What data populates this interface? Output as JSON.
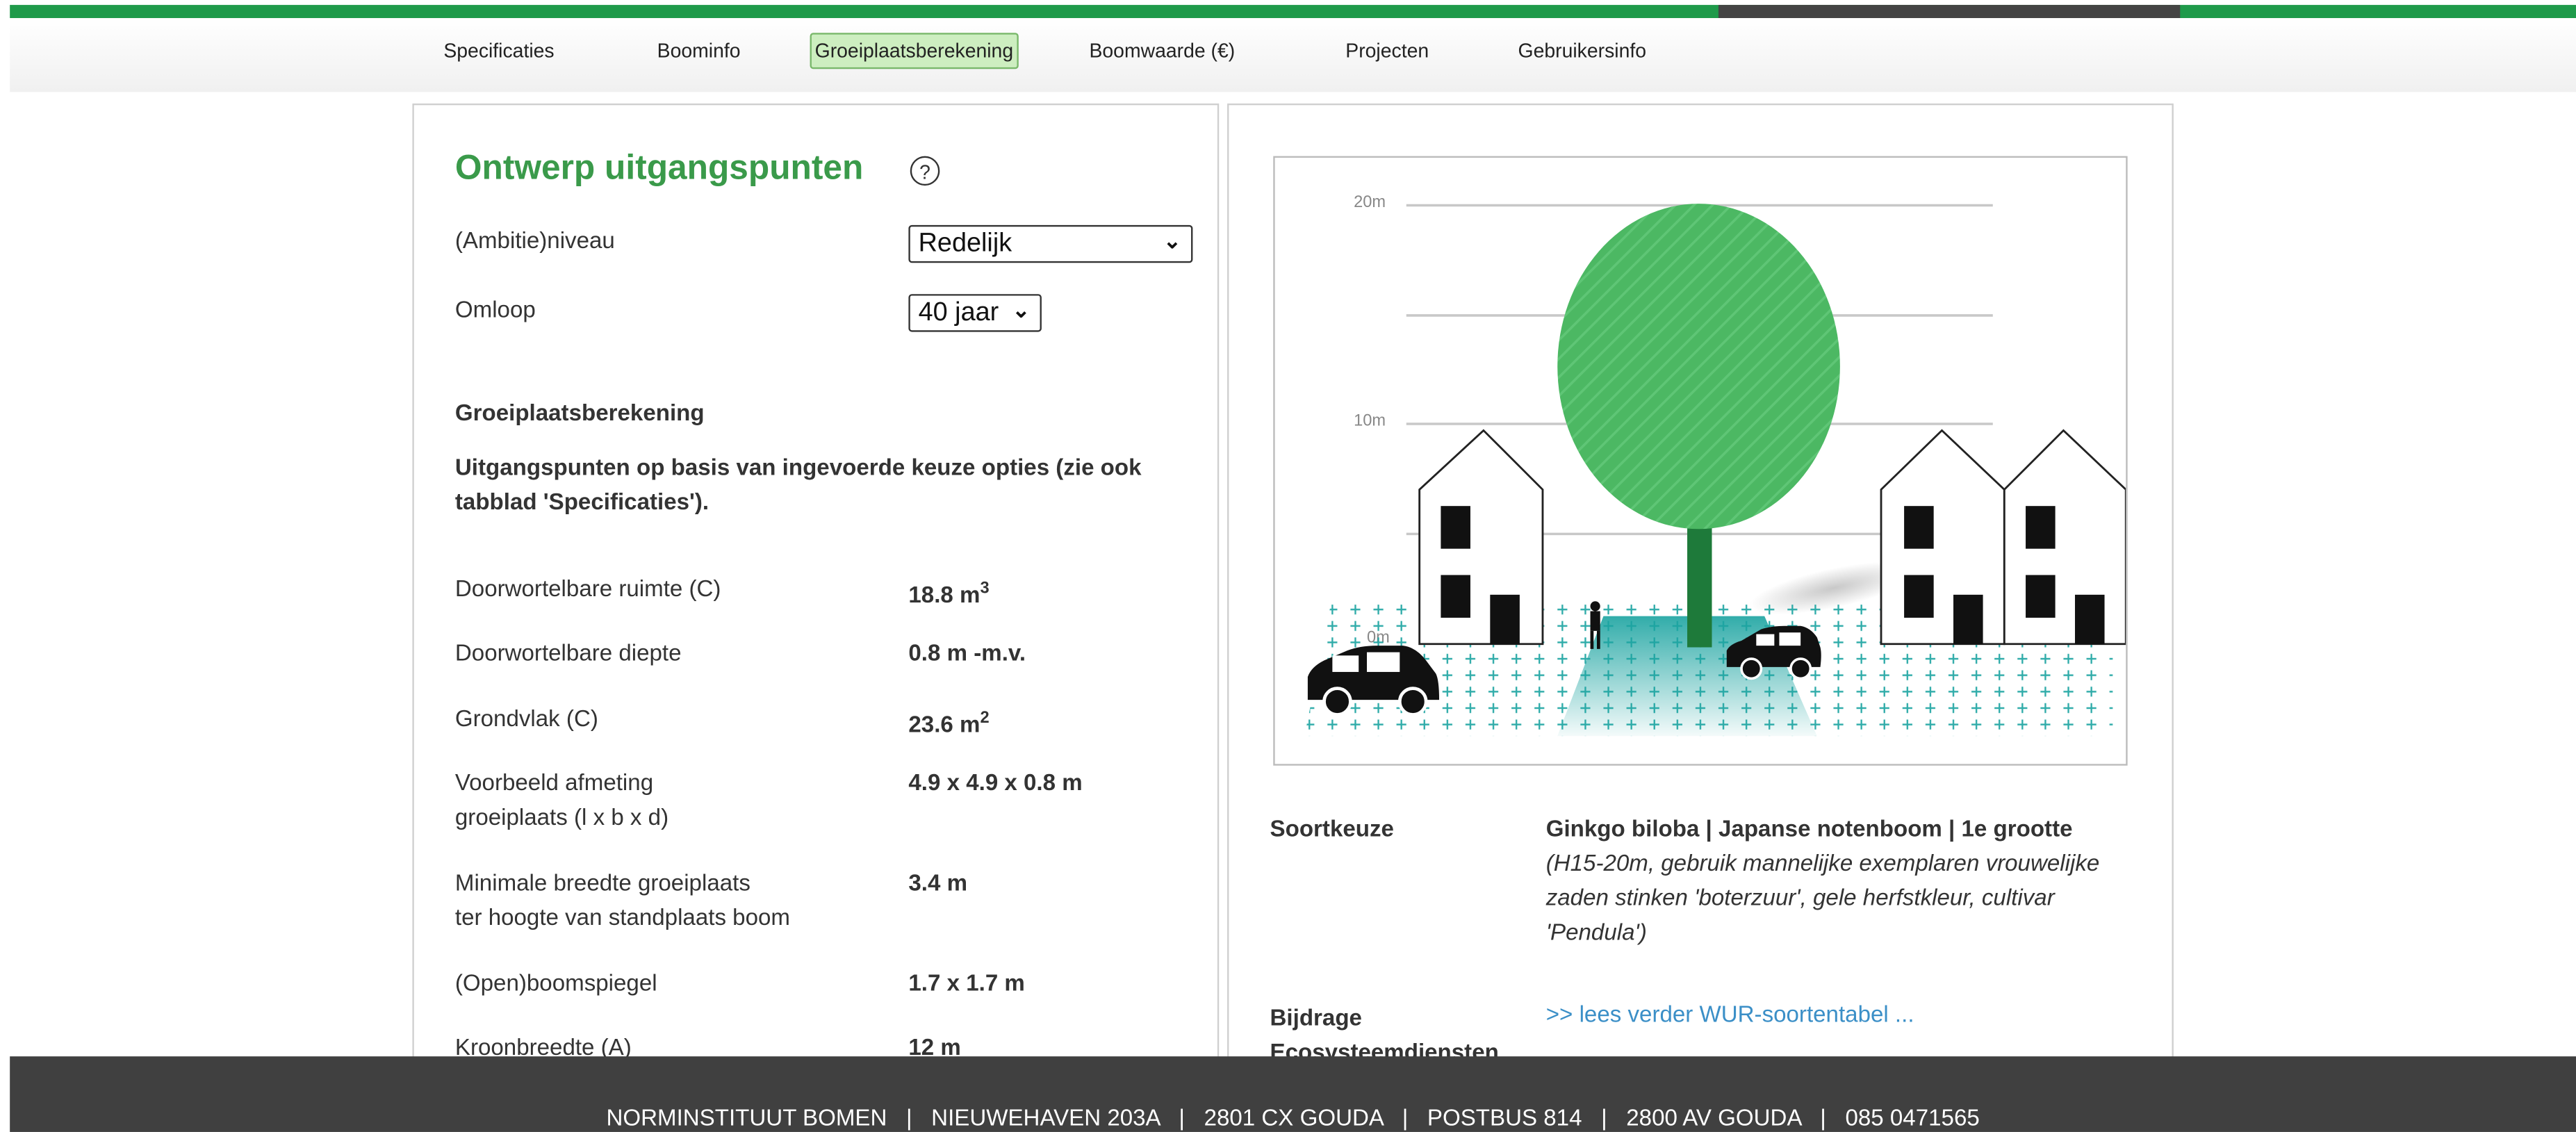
{
  "nav": {
    "items": [
      {
        "label": "Specificaties"
      },
      {
        "label": "Boominfo"
      },
      {
        "label": "Groeiplaatsberekening",
        "active": true
      },
      {
        "label": "Boomwaarde (€)"
      },
      {
        "label": "Projecten"
      },
      {
        "label": "Gebruikersinfo"
      }
    ]
  },
  "left": {
    "title": "Ontwerp uitgangspunten",
    "help_glyph": "?",
    "ambitie_label": "(Ambitie)niveau",
    "ambitie_value": "Redelijk",
    "omloop_label": "Omloop",
    "omloop_value": "40 jaar",
    "section_title": "Groeiplaatsberekening",
    "section_intro": "Uitgangspunten op basis van ingevoerde keuze opties (zie ook tabblad 'Specificaties').",
    "rows": [
      {
        "label": "Doorwortelbare ruimte (C)",
        "value": "18.8 m",
        "sup": "3"
      },
      {
        "label": "Doorwortelbare diepte",
        "value": "0.8 m -m.v."
      },
      {
        "label": "Grondvlak (C)",
        "value": "23.6 m",
        "sup": "2"
      },
      {
        "label": "Voorbeeld afmeting",
        "label2": "groeiplaats (l x b x d)",
        "value": "4.9 x 4.9 x 0.8 m"
      },
      {
        "label": "Minimale breedte groeiplaats",
        "label2": "ter hoogte van standplaats boom",
        "value": "3.4 m"
      },
      {
        "label": "(Open)boomspiegel",
        "value": "1.7 x 1.7 m"
      },
      {
        "label": "Kroonbreedte (A)",
        "value": "12 m"
      }
    ]
  },
  "illustration": {
    "height_labels": [
      "20m",
      "10m",
      "0m"
    ],
    "tree_color": "#4cb863",
    "trunk_color": "#1e7a3a",
    "soil_color": "#1aa3a0"
  },
  "right": {
    "soort_label": "Soortkeuze",
    "soort_name": "Ginkgo biloba | Japanse notenboom | 1e grootte",
    "soort_desc": "(H15-20m, gebruik mannelijke exemplaren vrouwelijke zaden stinken 'boterzuur', gele herfstkleur, cultivar 'Pendula')",
    "bijdrage_label": "Bijdrage Ecosysteemdiensten",
    "bijdrage_link": ">> lees verder WUR-soortentabel ..."
  },
  "footer": {
    "text": "NORMINSTITUUT BOMEN   |   NIEUWEHAVEN 203A   |   2801 CX GOUDA   |   POSTBUS 814   |   2800 AV GOUDA   |   085 0471565"
  },
  "colors": {
    "brand_green": "#1f9a4a",
    "title_green": "#3a9a4a",
    "active_tab_bg": "#cdeec0",
    "footer_bg": "#404040",
    "link": "#3b8fc7"
  }
}
